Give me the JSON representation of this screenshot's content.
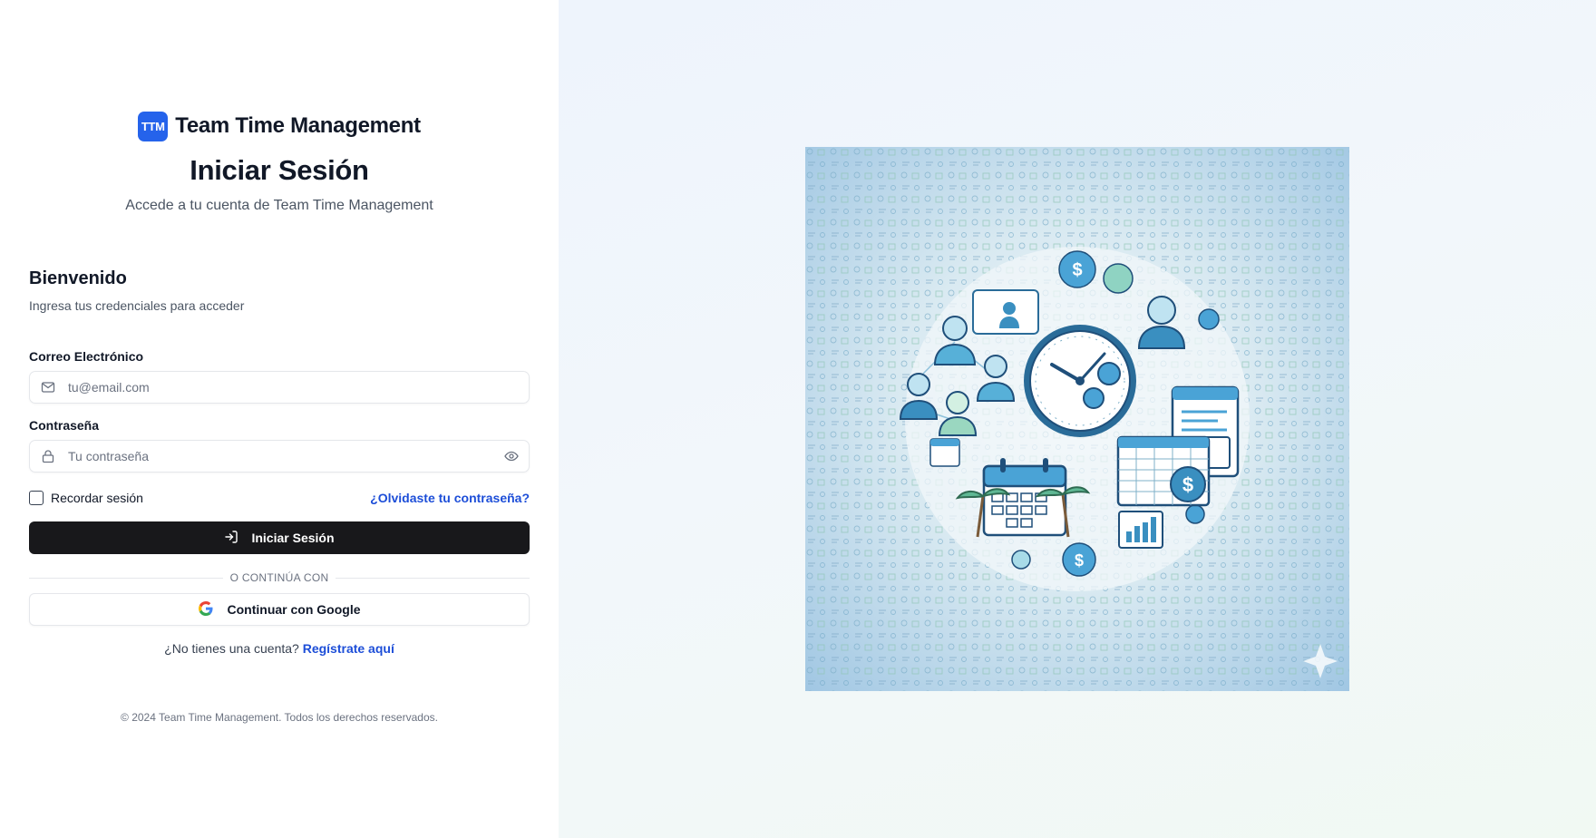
{
  "brand": {
    "logo_text": "TTM",
    "name": "Team Time Management",
    "accent_color": "#2563eb"
  },
  "header": {
    "title": "Iniciar Sesión",
    "subtitle": "Accede a tu cuenta de Team Time Management"
  },
  "form": {
    "welcome_title": "Bienvenido",
    "welcome_subtitle": "Ingresa tus credenciales para acceder",
    "email": {
      "label": "Correo Electrónico",
      "placeholder": "tu@email.com",
      "value": "",
      "icon": "mail-icon"
    },
    "password": {
      "label": "Contraseña",
      "placeholder": "Tu contraseña",
      "value": "",
      "icon": "lock-icon",
      "toggle_icon": "eye-icon"
    },
    "remember_label": "Recordar sesión",
    "remember_checked": false,
    "forgot_link": "¿Olvidaste tu contraseña?",
    "submit_label": "Iniciar Sesión",
    "submit_icon": "log-in-icon",
    "divider_text": "O CONTINÚA CON",
    "google_label": "Continuar con Google",
    "google_icon": "google-icon",
    "signup_prompt": "¿No tienes una cuenta?",
    "signup_link": "Regístrate aquí"
  },
  "footer": {
    "text": "© 2024 Team Time Management. Todos los derechos reservados."
  },
  "colors": {
    "link": "#1d4ed8",
    "primary_button": "#18181b"
  }
}
